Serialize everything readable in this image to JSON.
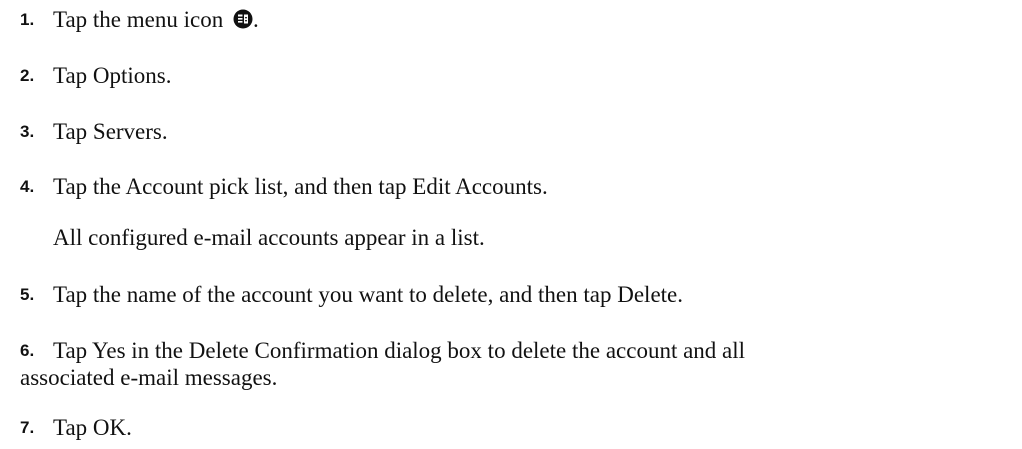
{
  "steps": [
    {
      "number": "1.",
      "text_before": "Tap the menu icon",
      "icon": "menu-icon",
      "text_after": "."
    },
    {
      "number": "2.",
      "text": "Tap Options."
    },
    {
      "number": "3.",
      "text": "Tap Servers."
    },
    {
      "number": "4.",
      "text": "Tap the Account pick list, and then tap Edit Accounts."
    },
    {
      "note": "All configured e-mail accounts appear in a list."
    },
    {
      "number": "5.",
      "text": "Tap the name of the account you want to delete, and then tap Delete."
    },
    {
      "number": "6.",
      "text_line1": "Tap Yes in the Delete Confirmation dialog box to delete the account and all",
      "text_line2": "associated e-mail messages."
    },
    {
      "number": "7.",
      "text": "Tap OK."
    }
  ]
}
